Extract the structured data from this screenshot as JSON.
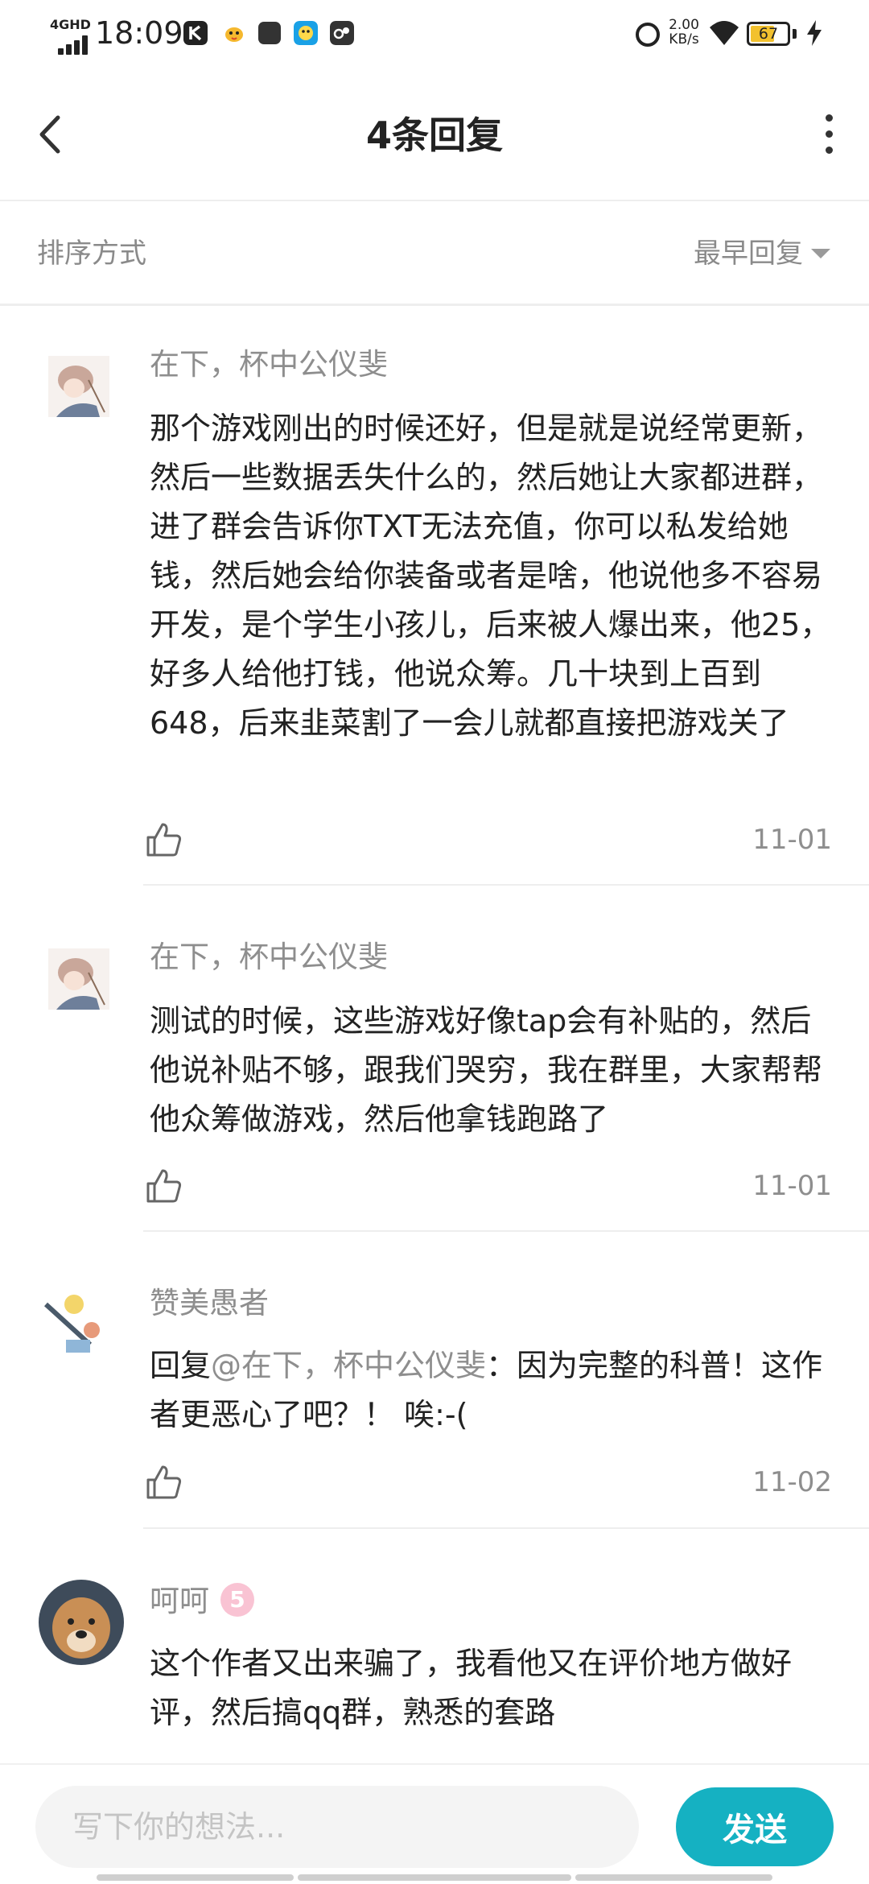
{
  "status_bar": {
    "network": "4GHD",
    "time": "18:09",
    "net_speed": "2.00 KB/s",
    "battery_level": "67",
    "battery_fraction": 0.67,
    "app_icons": [
      "k-app-icon",
      "bird-app-icon",
      "square-app-icon",
      "qq-app-icon",
      "game-app-icon"
    ]
  },
  "header": {
    "title": "4条回复"
  },
  "sort": {
    "label": "排序方式",
    "value": "最早回复"
  },
  "comments": [
    {
      "author": "在下，杯中公仪斐",
      "text": "那个游戏刚出的时候还好，但是就是说经常更新，然后一些数据丢失什么的，然后她让大家都进群，进了群会告诉你TXT无法充值，你可以私发给她钱，然后她会给你装备或者是啥，他说他多不容易开发，是个学生小孩儿，后来被人爆出来，他25，好多人给他打钱，他说众筹。几十块到上百到648，后来韭菜割了一会儿就都直接把游戏关了",
      "date": "11-01"
    },
    {
      "author": "在下，杯中公仪斐",
      "text": "测试的时候，这些游戏好像tap会有补贴的，然后他说补贴不够，跟我们哭穷，我在群里，大家帮帮他众筹做游戏，然后他拿钱跑路了",
      "date": "11-01"
    },
    {
      "author": "赞美愚者",
      "reply_prefix": "回复",
      "mention": "@在下，杯中公仪斐",
      "text": "：因为完整的科普！这作者更恶心了吧？！ 唉:-(",
      "date": "11-02"
    },
    {
      "author": "呵呵",
      "badge": "5",
      "text": "这个作者又出来骗了，我看他又在评价地方做好评，然后搞qq群，熟悉的套路"
    }
  ],
  "composer": {
    "placeholder": "写下你的想法...",
    "send_label": "发送"
  },
  "colors": {
    "accent": "#15b1c2",
    "secondary_text": "#8e8e8e",
    "divider": "#eeeeee",
    "badge": "#f9c3d3",
    "battery": "#f2c12e"
  }
}
